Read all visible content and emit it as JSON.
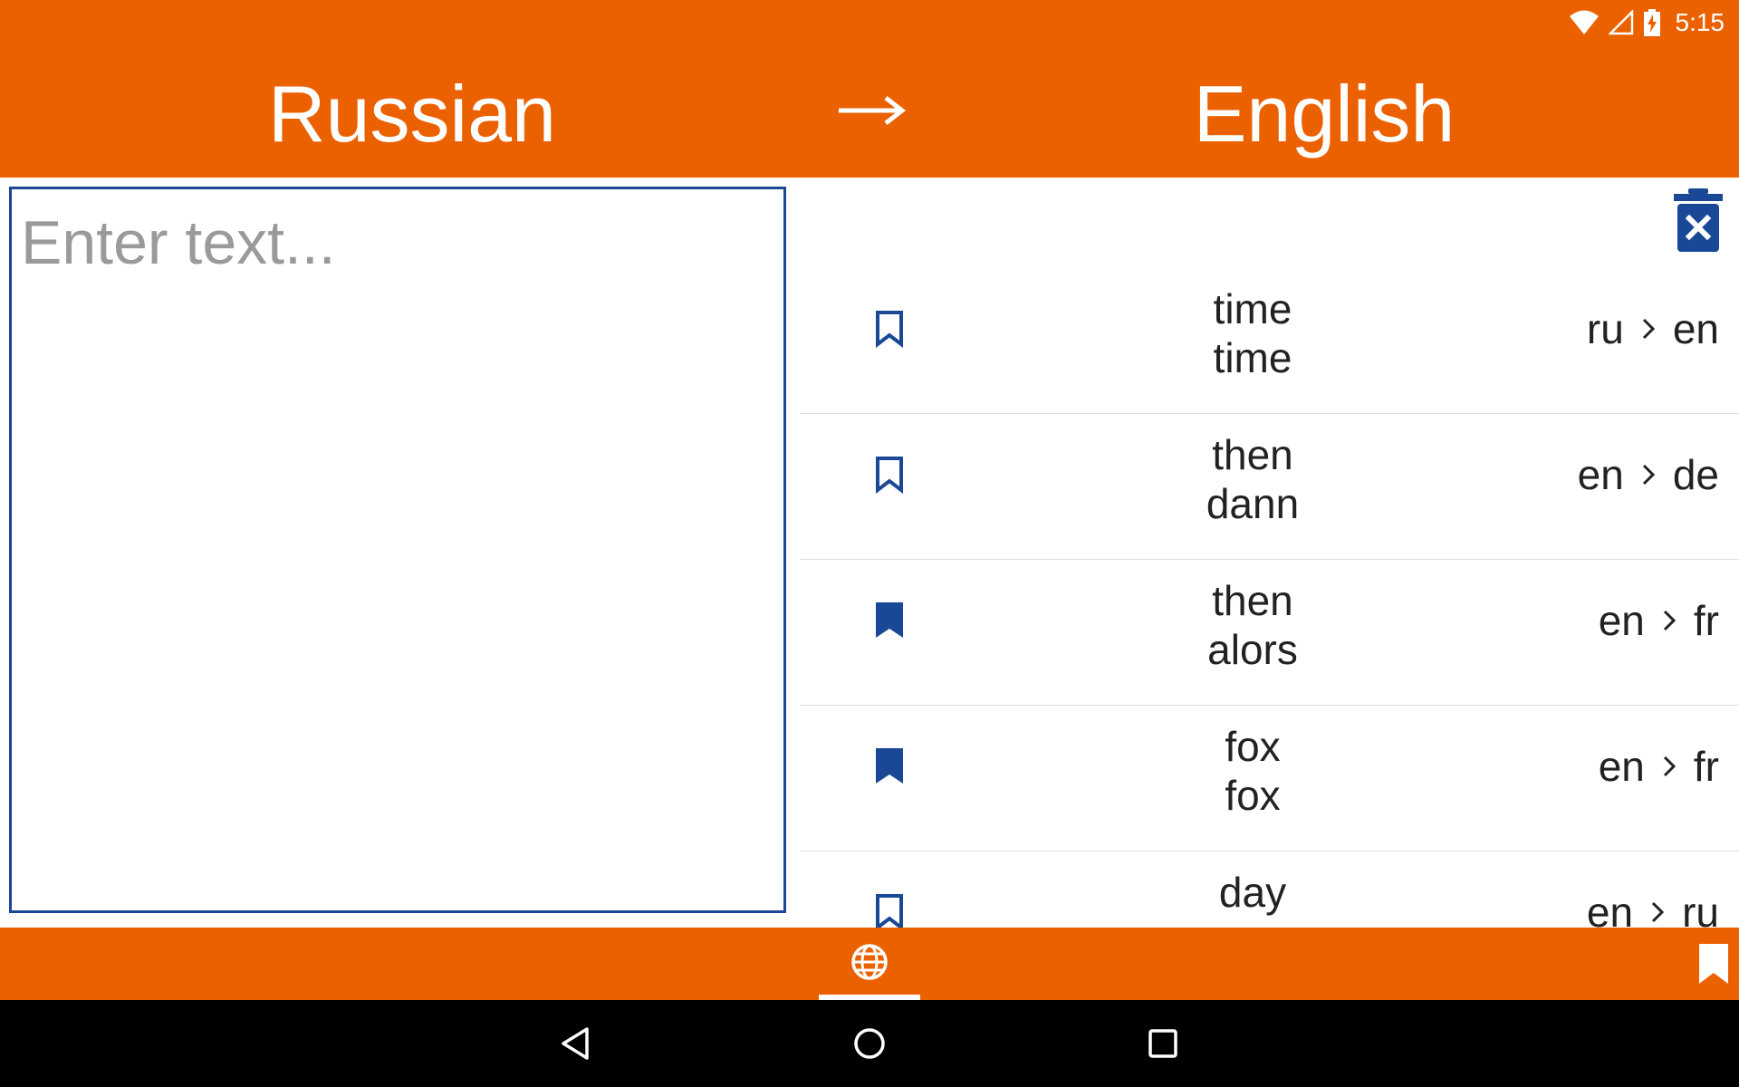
{
  "status_bar": {
    "time": "5:15"
  },
  "header": {
    "source_language": "Russian",
    "target_language": "English",
    "swap_icon": "arrow-right-icon"
  },
  "input": {
    "placeholder": "Enter text..."
  },
  "history": {
    "clear_icon": "delete-icon",
    "items": [
      {
        "source": "time",
        "translation": "time",
        "from": "ru",
        "to": "en",
        "bookmarked": false
      },
      {
        "source": "then",
        "translation": "dann",
        "from": "en",
        "to": "de",
        "bookmarked": false
      },
      {
        "source": "then",
        "translation": "alors",
        "from": "en",
        "to": "fr",
        "bookmarked": true
      },
      {
        "source": "fox",
        "translation": "fox",
        "from": "en",
        "to": "fr",
        "bookmarked": true
      },
      {
        "source": "day",
        "translation": "",
        "from": "en",
        "to": "ru",
        "bookmarked": false
      }
    ]
  },
  "tabs": [
    {
      "icon": "globe-icon",
      "active": true
    },
    {
      "icon": "bookmark-icon",
      "active": false
    }
  ],
  "colors": {
    "accent": "#eb6100",
    "primary_blue": "#1a4897"
  }
}
